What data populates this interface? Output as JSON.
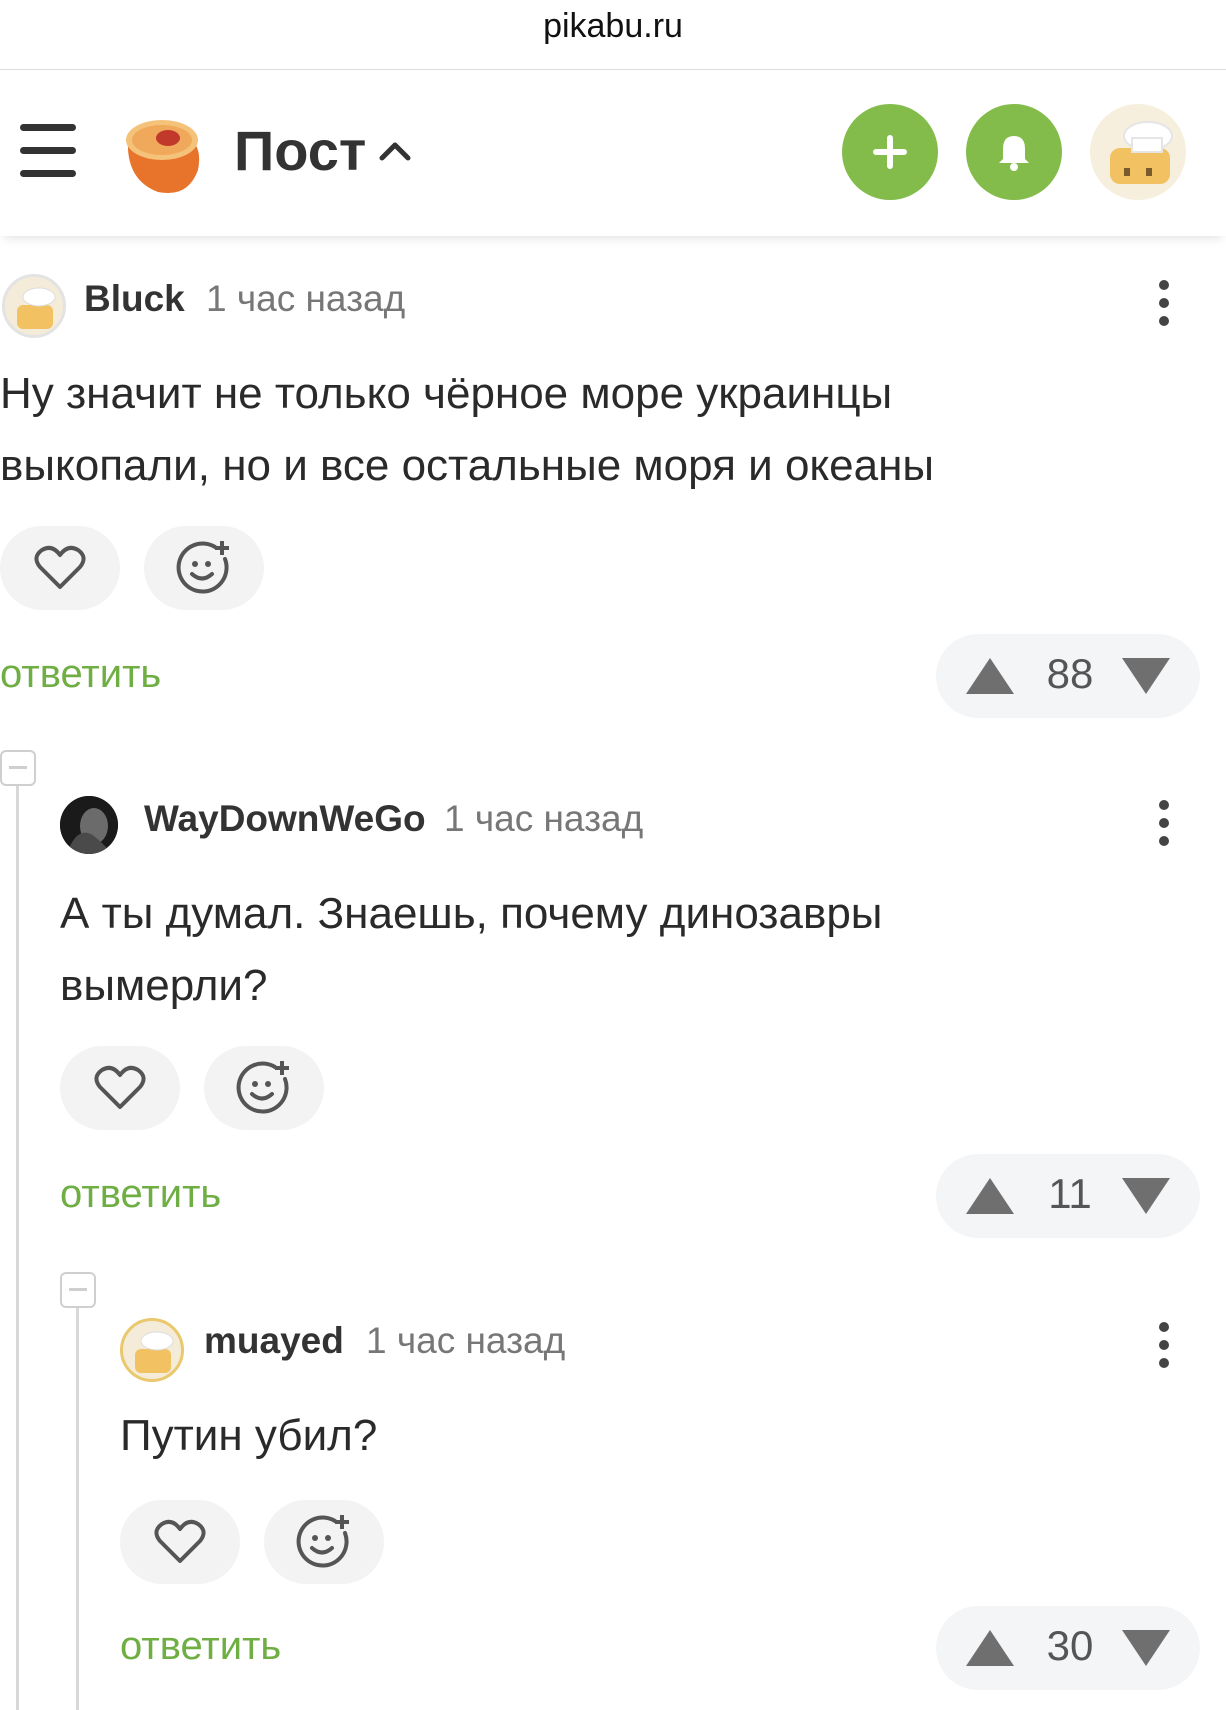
{
  "browser": {
    "url": "pikabu.ru"
  },
  "header": {
    "title": "Пост",
    "add_icon": "plus-icon",
    "notify_icon": "bell-icon",
    "brand_color": "#84bc4c"
  },
  "comments": [
    {
      "username": "Bluck",
      "time": "1 час назад",
      "text": "Ну значит не только чёрное море украинцы выкопали, но и все остальные моря и океаны",
      "reply": "ответить",
      "rating": "88"
    },
    {
      "username": "WayDownWeGo",
      "time": "1 час назад",
      "text": "А ты думал. Знаешь, почему динозавры вымерли?",
      "reply": "ответить",
      "rating": "11"
    },
    {
      "username": "muayed",
      "time": "1 час назад",
      "text": "Путин убил?",
      "reply": "ответить",
      "rating": "30"
    }
  ]
}
